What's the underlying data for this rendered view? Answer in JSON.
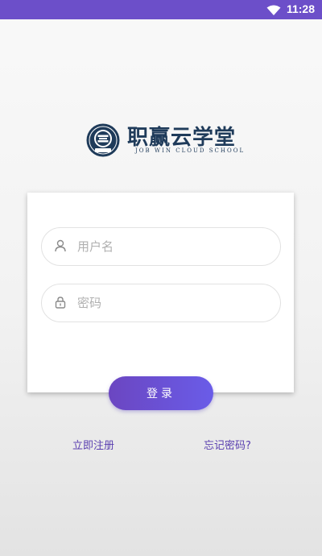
{
  "status_bar": {
    "time": "11:28",
    "wifi_icon": "wifi-icon",
    "background": "#6c4fc9"
  },
  "logo": {
    "title": "职赢云学堂",
    "subtitle": "JOB WIN CLOUD SCHOOL",
    "emblem_icon": "school-emblem-icon",
    "color": "#1f3b5a"
  },
  "login_form": {
    "username": {
      "placeholder": "用户名",
      "value": "",
      "icon": "user-icon"
    },
    "password": {
      "placeholder": "密码",
      "value": "",
      "icon": "lock-icon"
    },
    "submit_label": "登录"
  },
  "links": {
    "register": "立即注册",
    "forgot_password": "忘记密码?"
  },
  "colors": {
    "accent": "#6b46c1",
    "accent_end": "#6a5ce8",
    "link": "#5a3fb0"
  }
}
